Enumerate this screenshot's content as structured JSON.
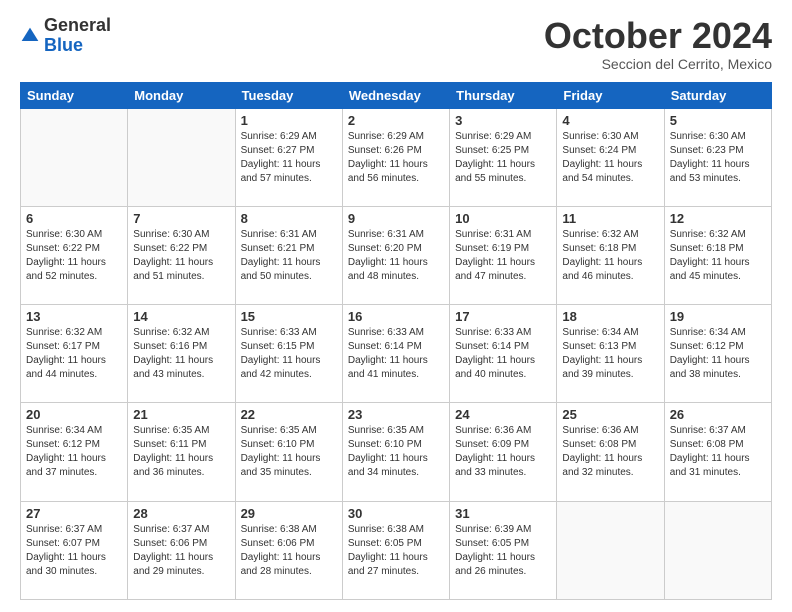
{
  "logo": {
    "general": "General",
    "blue": "Blue"
  },
  "header": {
    "title": "October 2024",
    "subtitle": "Seccion del Cerrito, Mexico"
  },
  "days_of_week": [
    "Sunday",
    "Monday",
    "Tuesday",
    "Wednesday",
    "Thursday",
    "Friday",
    "Saturday"
  ],
  "weeks": [
    [
      {
        "day": "",
        "info": ""
      },
      {
        "day": "",
        "info": ""
      },
      {
        "day": "1",
        "info": "Sunrise: 6:29 AM\nSunset: 6:27 PM\nDaylight: 11 hours and 57 minutes."
      },
      {
        "day": "2",
        "info": "Sunrise: 6:29 AM\nSunset: 6:26 PM\nDaylight: 11 hours and 56 minutes."
      },
      {
        "day": "3",
        "info": "Sunrise: 6:29 AM\nSunset: 6:25 PM\nDaylight: 11 hours and 55 minutes."
      },
      {
        "day": "4",
        "info": "Sunrise: 6:30 AM\nSunset: 6:24 PM\nDaylight: 11 hours and 54 minutes."
      },
      {
        "day": "5",
        "info": "Sunrise: 6:30 AM\nSunset: 6:23 PM\nDaylight: 11 hours and 53 minutes."
      }
    ],
    [
      {
        "day": "6",
        "info": "Sunrise: 6:30 AM\nSunset: 6:22 PM\nDaylight: 11 hours and 52 minutes."
      },
      {
        "day": "7",
        "info": "Sunrise: 6:30 AM\nSunset: 6:22 PM\nDaylight: 11 hours and 51 minutes."
      },
      {
        "day": "8",
        "info": "Sunrise: 6:31 AM\nSunset: 6:21 PM\nDaylight: 11 hours and 50 minutes."
      },
      {
        "day": "9",
        "info": "Sunrise: 6:31 AM\nSunset: 6:20 PM\nDaylight: 11 hours and 48 minutes."
      },
      {
        "day": "10",
        "info": "Sunrise: 6:31 AM\nSunset: 6:19 PM\nDaylight: 11 hours and 47 minutes."
      },
      {
        "day": "11",
        "info": "Sunrise: 6:32 AM\nSunset: 6:18 PM\nDaylight: 11 hours and 46 minutes."
      },
      {
        "day": "12",
        "info": "Sunrise: 6:32 AM\nSunset: 6:18 PM\nDaylight: 11 hours and 45 minutes."
      }
    ],
    [
      {
        "day": "13",
        "info": "Sunrise: 6:32 AM\nSunset: 6:17 PM\nDaylight: 11 hours and 44 minutes."
      },
      {
        "day": "14",
        "info": "Sunrise: 6:32 AM\nSunset: 6:16 PM\nDaylight: 11 hours and 43 minutes."
      },
      {
        "day": "15",
        "info": "Sunrise: 6:33 AM\nSunset: 6:15 PM\nDaylight: 11 hours and 42 minutes."
      },
      {
        "day": "16",
        "info": "Sunrise: 6:33 AM\nSunset: 6:14 PM\nDaylight: 11 hours and 41 minutes."
      },
      {
        "day": "17",
        "info": "Sunrise: 6:33 AM\nSunset: 6:14 PM\nDaylight: 11 hours and 40 minutes."
      },
      {
        "day": "18",
        "info": "Sunrise: 6:34 AM\nSunset: 6:13 PM\nDaylight: 11 hours and 39 minutes."
      },
      {
        "day": "19",
        "info": "Sunrise: 6:34 AM\nSunset: 6:12 PM\nDaylight: 11 hours and 38 minutes."
      }
    ],
    [
      {
        "day": "20",
        "info": "Sunrise: 6:34 AM\nSunset: 6:12 PM\nDaylight: 11 hours and 37 minutes."
      },
      {
        "day": "21",
        "info": "Sunrise: 6:35 AM\nSunset: 6:11 PM\nDaylight: 11 hours and 36 minutes."
      },
      {
        "day": "22",
        "info": "Sunrise: 6:35 AM\nSunset: 6:10 PM\nDaylight: 11 hours and 35 minutes."
      },
      {
        "day": "23",
        "info": "Sunrise: 6:35 AM\nSunset: 6:10 PM\nDaylight: 11 hours and 34 minutes."
      },
      {
        "day": "24",
        "info": "Sunrise: 6:36 AM\nSunset: 6:09 PM\nDaylight: 11 hours and 33 minutes."
      },
      {
        "day": "25",
        "info": "Sunrise: 6:36 AM\nSunset: 6:08 PM\nDaylight: 11 hours and 32 minutes."
      },
      {
        "day": "26",
        "info": "Sunrise: 6:37 AM\nSunset: 6:08 PM\nDaylight: 11 hours and 31 minutes."
      }
    ],
    [
      {
        "day": "27",
        "info": "Sunrise: 6:37 AM\nSunset: 6:07 PM\nDaylight: 11 hours and 30 minutes."
      },
      {
        "day": "28",
        "info": "Sunrise: 6:37 AM\nSunset: 6:06 PM\nDaylight: 11 hours and 29 minutes."
      },
      {
        "day": "29",
        "info": "Sunrise: 6:38 AM\nSunset: 6:06 PM\nDaylight: 11 hours and 28 minutes."
      },
      {
        "day": "30",
        "info": "Sunrise: 6:38 AM\nSunset: 6:05 PM\nDaylight: 11 hours and 27 minutes."
      },
      {
        "day": "31",
        "info": "Sunrise: 6:39 AM\nSunset: 6:05 PM\nDaylight: 11 hours and 26 minutes."
      },
      {
        "day": "",
        "info": ""
      },
      {
        "day": "",
        "info": ""
      }
    ]
  ]
}
